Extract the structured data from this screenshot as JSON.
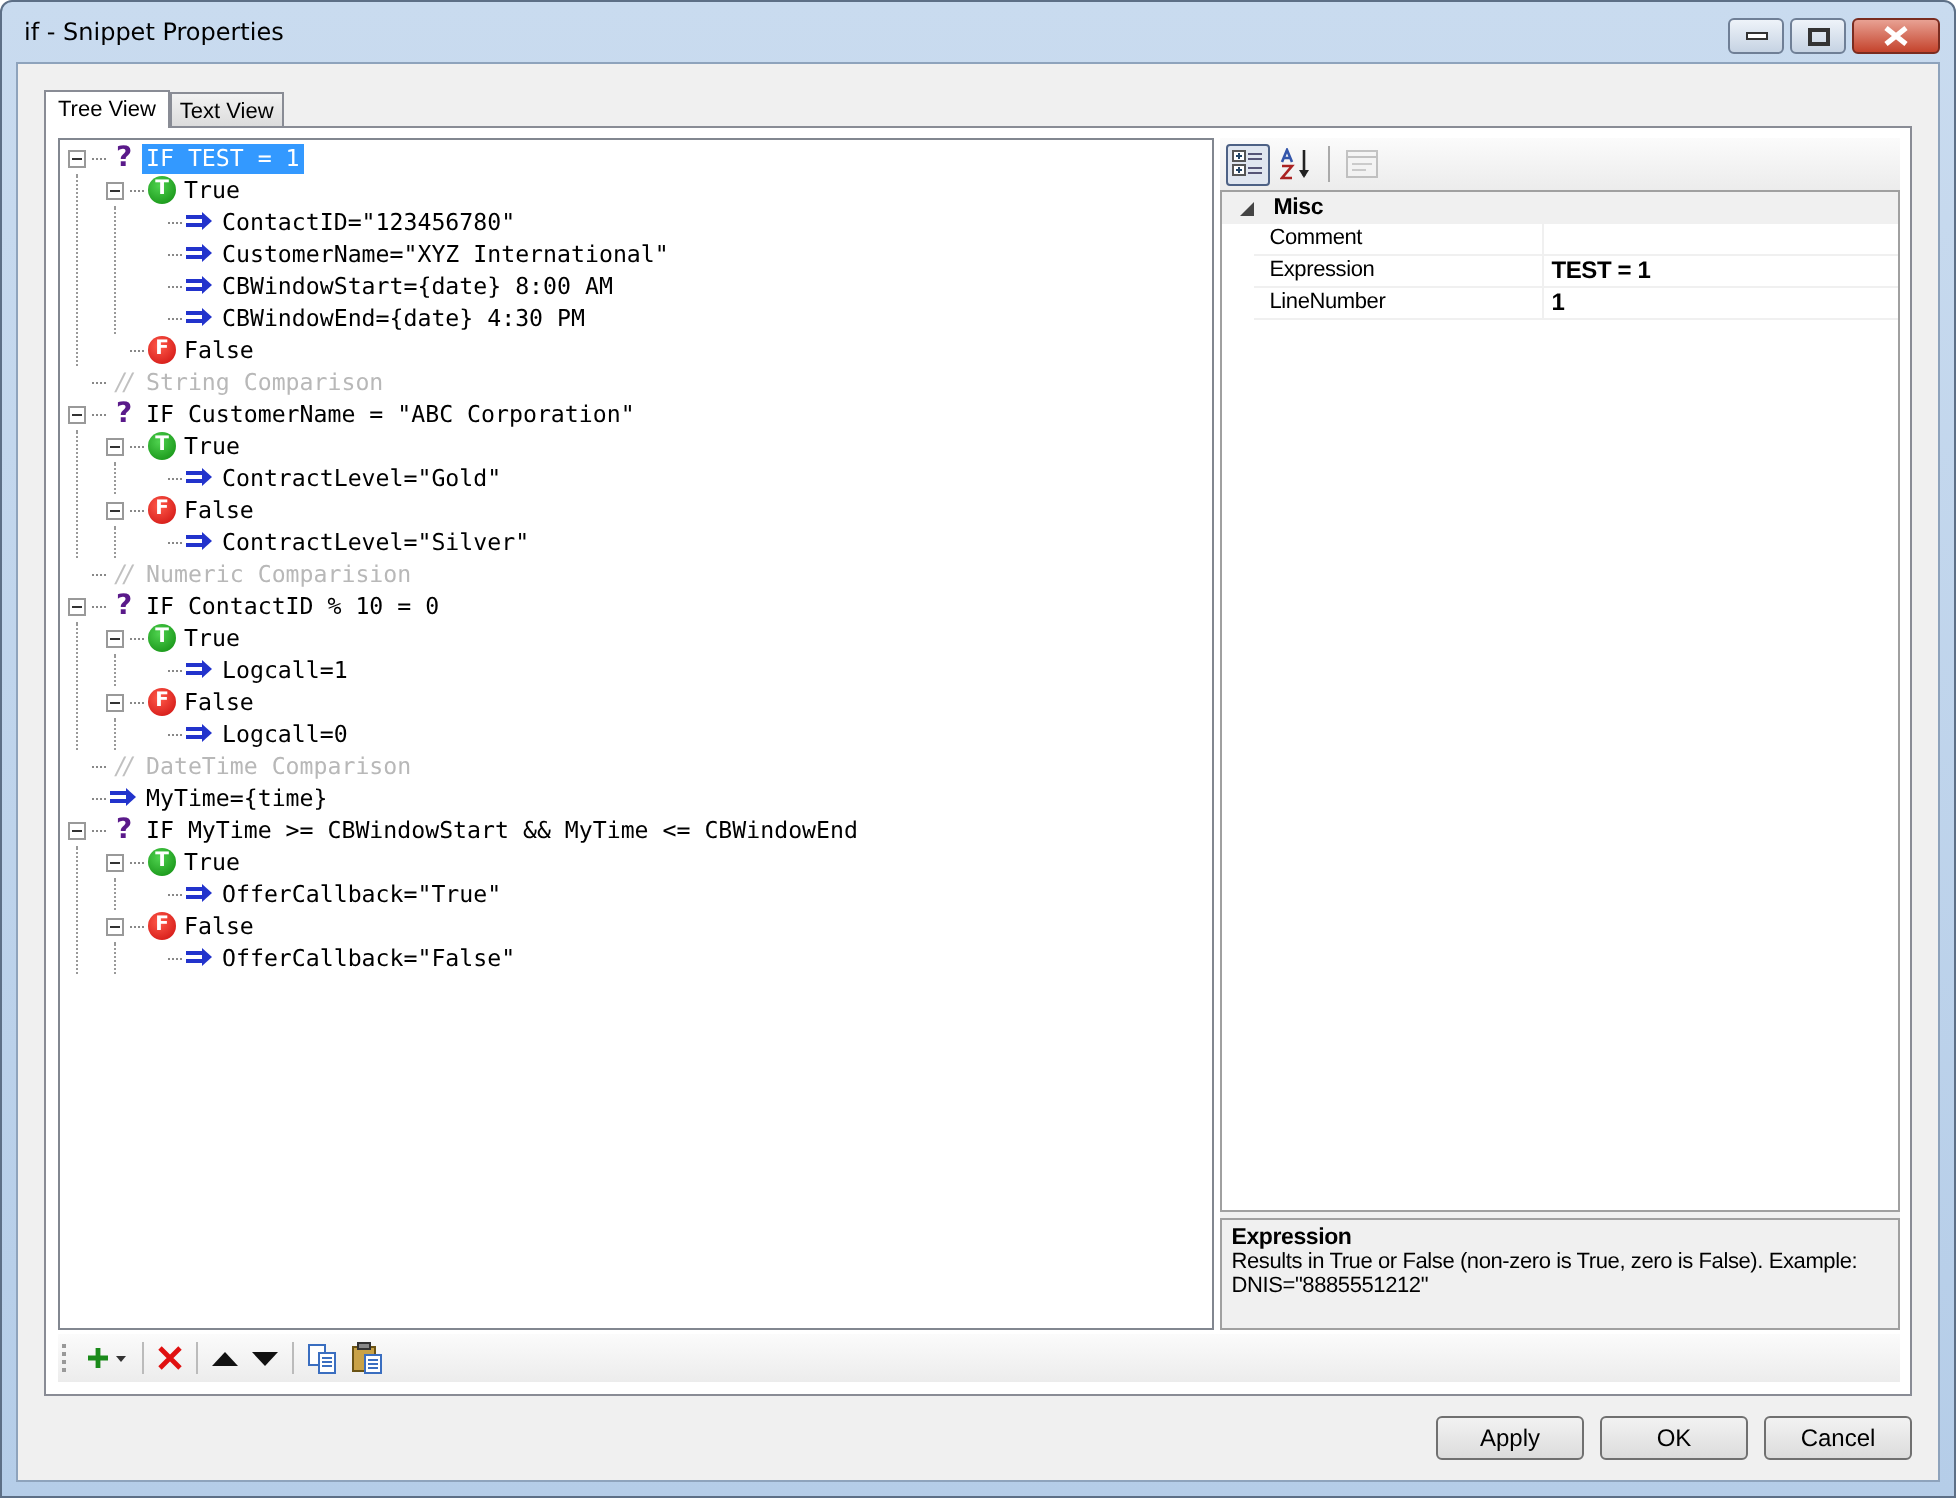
{
  "window": {
    "title": "if - Snippet Properties"
  },
  "tabs": [
    {
      "label": "Tree View",
      "selected": true
    },
    {
      "label": "Text View",
      "selected": false
    }
  ],
  "tree": [
    {
      "kind": "if",
      "glyph": "?",
      "text": "IF TEST = 1",
      "selected": true,
      "expanded": true,
      "children": [
        {
          "kind": "true",
          "glyph": "T",
          "text": "True",
          "selected": false,
          "expanded": true,
          "children": [
            {
              "kind": "assign",
              "text": "ContactID=\"123456780\"",
              "selected": false
            },
            {
              "kind": "assign",
              "text": "CustomerName=\"XYZ International\"",
              "selected": false
            },
            {
              "kind": "assign",
              "text": "CBWindowStart={date} 8:00 AM",
              "selected": false
            },
            {
              "kind": "assign",
              "text": "CBWindowEnd={date} 4:30 PM",
              "selected": false
            }
          ]
        },
        {
          "kind": "false",
          "glyph": "F",
          "text": "False",
          "selected": false
        }
      ]
    },
    {
      "kind": "comment",
      "glyph": "//",
      "text": "String Comparison",
      "selected": false
    },
    {
      "kind": "if",
      "glyph": "?",
      "text": "IF CustomerName = \"ABC Corporation\"",
      "selected": false,
      "expanded": true,
      "children": [
        {
          "kind": "true",
          "glyph": "T",
          "text": "True",
          "selected": false,
          "expanded": true,
          "children": [
            {
              "kind": "assign",
              "text": "ContractLevel=\"Gold\"",
              "selected": false
            }
          ]
        },
        {
          "kind": "false",
          "glyph": "F",
          "text": "False",
          "selected": false,
          "expanded": true,
          "children": [
            {
              "kind": "assign",
              "text": "ContractLevel=\"Silver\"",
              "selected": false
            }
          ]
        }
      ]
    },
    {
      "kind": "comment",
      "glyph": "//",
      "text": "Numeric Comparision",
      "selected": false
    },
    {
      "kind": "if",
      "glyph": "?",
      "text": "IF ContactID % 10 = 0",
      "selected": false,
      "expanded": true,
      "children": [
        {
          "kind": "true",
          "glyph": "T",
          "text": "True",
          "selected": false,
          "expanded": true,
          "children": [
            {
              "kind": "assign",
              "text": "Logcall=1",
              "selected": false
            }
          ]
        },
        {
          "kind": "false",
          "glyph": "F",
          "text": "False",
          "selected": false,
          "expanded": true,
          "children": [
            {
              "kind": "assign",
              "text": "Logcall=0",
              "selected": false
            }
          ]
        }
      ]
    },
    {
      "kind": "comment",
      "glyph": "//",
      "text": "DateTime Comparison",
      "selected": false
    },
    {
      "kind": "assign",
      "text": "MyTime={time}",
      "selected": false
    },
    {
      "kind": "if",
      "glyph": "?",
      "text": "IF MyTime >= CBWindowStart && MyTime <= CBWindowEnd",
      "selected": false,
      "expanded": true,
      "children": [
        {
          "kind": "true",
          "glyph": "T",
          "text": "True",
          "selected": false,
          "expanded": true,
          "children": [
            {
              "kind": "assign",
              "text": "OfferCallback=\"True\"",
              "selected": false
            }
          ]
        },
        {
          "kind": "false",
          "glyph": "F",
          "text": "False",
          "selected": false,
          "expanded": true,
          "children": [
            {
              "kind": "assign",
              "text": "OfferCallback=\"False\"",
              "selected": false
            }
          ]
        }
      ]
    }
  ],
  "properties": {
    "toolbar": [
      {
        "kind": "categorized",
        "selected": true,
        "disabled": false
      },
      {
        "kind": "alphabetical",
        "selected": false,
        "disabled": false
      },
      {
        "kind": "pages",
        "selected": false,
        "disabled": true
      }
    ],
    "category": {
      "name": "Misc",
      "expanded": true
    },
    "rows": [
      {
        "name": "Comment"
      },
      {
        "name": "Expression",
        "value": "TEST = 1"
      },
      {
        "name": "LineNumber",
        "value": "1"
      }
    ],
    "help": {
      "title": "Expression",
      "text": "Results in True or False (non-zero is True, zero is False). Example: DNIS=\"8885551212\""
    }
  },
  "toolbar": [
    {
      "kind": "add"
    },
    {
      "kind": "separator"
    },
    {
      "kind": "delete"
    },
    {
      "kind": "separator"
    },
    {
      "kind": "up"
    },
    {
      "kind": "down"
    },
    {
      "kind": "separator"
    },
    {
      "kind": "copy"
    },
    {
      "kind": "paste"
    }
  ],
  "buttons": [
    "Apply",
    "OK",
    "Cancel"
  ]
}
